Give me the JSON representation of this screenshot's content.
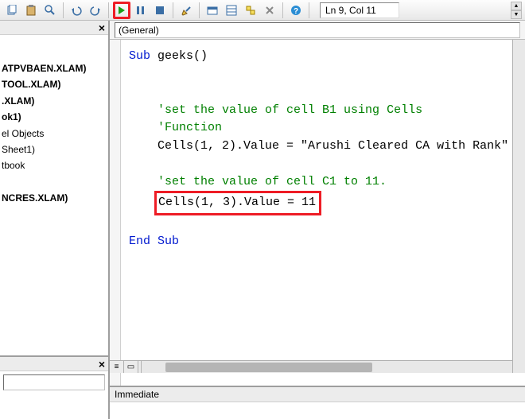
{
  "toolbar": {
    "status": "Ln 9, Col 11"
  },
  "dropdown": {
    "object": "(General)"
  },
  "project_tree": {
    "items": [
      "ATPVBAEN.XLAM)",
      "TOOL.XLAM)",
      ".XLAM)",
      "ok1)",
      "el Objects",
      "Sheet1)",
      "tbook",
      "NCRES.XLAM)"
    ]
  },
  "code": {
    "line1_kw": "Sub ",
    "line1_name": "geeks()",
    "comment1": "'set the value of cell B1 using Cells",
    "comment2": "'Function",
    "line_cells1_a": "Cells(1, 2).Value = ",
    "line_cells1_str": "\"Arushi Cleared CA with Rank\"",
    "comment3": "'set the value of cell C1 to 11.",
    "line_cells2": "Cells(1, 3).Value = 11",
    "end_sub": "End Sub"
  },
  "immediate": {
    "title": "Immediate"
  }
}
